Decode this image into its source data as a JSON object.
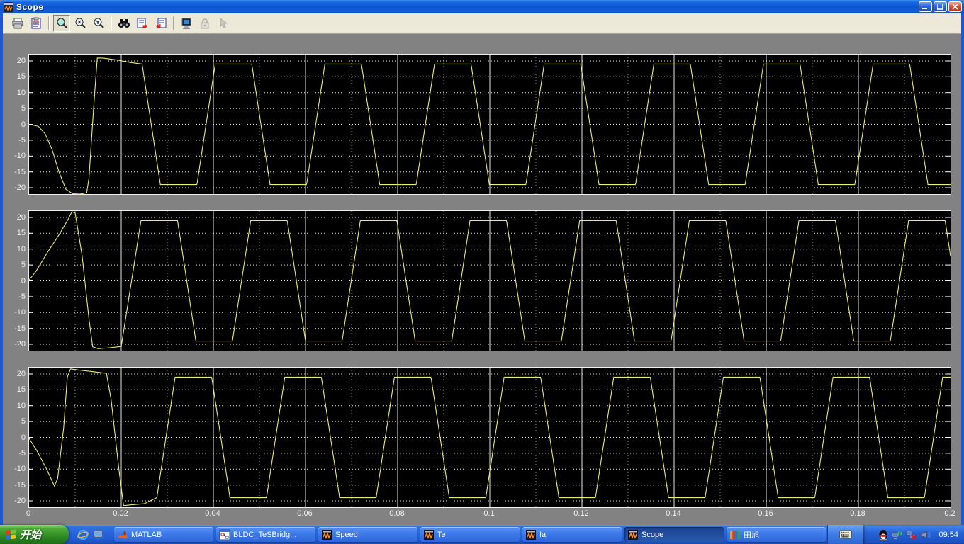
{
  "window": {
    "title": "Scope"
  },
  "toolbar": {
    "buttons": [
      {
        "name": "print-button"
      },
      {
        "name": "parameters-button"
      },
      {
        "name": "zoom-button",
        "pressed": true
      },
      {
        "name": "zoom-x-button"
      },
      {
        "name": "zoom-y-button"
      },
      {
        "name": "autoscale-button"
      },
      {
        "name": "save-axes-settings-button"
      },
      {
        "name": "restore-axes-settings-button"
      },
      {
        "name": "floating-scope-button"
      },
      {
        "name": "lock-axes-button",
        "disabled": true
      },
      {
        "name": "signal-selection-button",
        "disabled": true
      }
    ]
  },
  "chart_data": {
    "type": "line",
    "title": "",
    "xlabel": "",
    "ylabel": "",
    "xlim": [
      0,
      0.2
    ],
    "ylim": [
      -22,
      22
    ],
    "xticks": [
      0,
      0.02,
      0.04,
      0.06,
      0.08,
      0.1,
      0.12,
      0.14,
      0.16,
      0.18,
      0.2
    ],
    "xtick_labels": [
      "0",
      "0.02",
      "0.04",
      "0.06",
      "0.08",
      "0.1",
      "0.12",
      "0.14",
      "0.16",
      "0.18",
      "0.2"
    ],
    "yticks": [
      20,
      15,
      10,
      5,
      0,
      -5,
      -10,
      -15,
      -20
    ],
    "grid": "dotted-white-on-black",
    "line_color": "#ecec72",
    "plots": [
      {
        "name": "phase-current-a",
        "transient": [
          [
            0,
            0
          ],
          [
            0.002,
            -0.6
          ],
          [
            0.0035,
            -3
          ],
          [
            0.005,
            -8
          ],
          [
            0.0065,
            -15
          ],
          [
            0.008,
            -20.5
          ],
          [
            0.0095,
            -21.9
          ],
          [
            0.011,
            -22
          ],
          [
            0.0125,
            -21.6
          ],
          [
            0.013,
            -17
          ],
          [
            0.014,
            5
          ],
          [
            0.0148,
            20.9
          ],
          [
            0.016,
            20.9
          ],
          [
            0.019,
            20.3
          ],
          [
            0.022,
            19.5
          ],
          [
            0.0245,
            19
          ]
        ],
        "steady": {
          "period": 0.0238,
          "amplitude": 19,
          "top_start": 0.0166,
          "handoff": 0.0245,
          "flat_fraction": 0.3333,
          "ramp_fraction": 0.1667
        }
      },
      {
        "name": "phase-current-b",
        "transient": [
          [
            0,
            0.3
          ],
          [
            0.0015,
            3
          ],
          [
            0.004,
            9
          ],
          [
            0.0065,
            14.5
          ],
          [
            0.0085,
            19.5
          ],
          [
            0.0093,
            21.8
          ],
          [
            0.01,
            21.4
          ],
          [
            0.0115,
            8
          ],
          [
            0.013,
            -12
          ],
          [
            0.0138,
            -20.8
          ],
          [
            0.015,
            -21.4
          ],
          [
            0.0175,
            -21.1
          ],
          [
            0.02,
            -20.7
          ],
          [
            0.0243,
            19
          ]
        ],
        "steady": {
          "period": 0.0238,
          "amplitude": 19,
          "top_start": 0.0243,
          "handoff": 0.0243,
          "flat_fraction": 0.3333,
          "ramp_fraction": 0.1667
        }
      },
      {
        "name": "phase-current-c",
        "transient": [
          [
            0,
            -0.3
          ],
          [
            0.0018,
            -4.5
          ],
          [
            0.0038,
            -10
          ],
          [
            0.0055,
            -15.3
          ],
          [
            0.0062,
            -13
          ],
          [
            0.0075,
            3
          ],
          [
            0.0083,
            19
          ],
          [
            0.009,
            21.6
          ],
          [
            0.011,
            21.2
          ],
          [
            0.014,
            20.7
          ],
          [
            0.0168,
            20.2
          ],
          [
            0.0178,
            12
          ],
          [
            0.0195,
            -10
          ],
          [
            0.0205,
            -21.5
          ],
          [
            0.0225,
            -21.2
          ],
          [
            0.025,
            -20.9
          ],
          [
            0.0277,
            -19
          ]
        ],
        "steady": {
          "period": 0.0238,
          "amplitude": 19,
          "top_start": 0.0317,
          "handoff": 0.0277,
          "flat_fraction": 0.3333,
          "ramp_fraction": 0.1667
        }
      }
    ]
  },
  "taskbar": {
    "start_label": "开始",
    "quick_launch": [
      "internet-explorer-icon",
      "show-desktop-icon"
    ],
    "tasks": [
      {
        "label": "MATLAB",
        "icon": "matlab-icon",
        "active": false
      },
      {
        "label": "BLDC_TeSBridg...",
        "icon": "simulink-model-icon",
        "active": false
      },
      {
        "label": "Speed",
        "icon": "scope-icon",
        "active": false
      },
      {
        "label": "Te",
        "icon": "scope-icon",
        "active": false
      },
      {
        "label": "Ia",
        "icon": "scope-icon",
        "active": false
      },
      {
        "label": "Scope",
        "icon": "scope-icon",
        "active": true
      },
      {
        "label": "田旭",
        "icon": "folder-icon",
        "active": false
      }
    ],
    "language_indicator": "keyboard-icon",
    "tray": {
      "icons": [
        "qq-icon",
        "network-activity-icon",
        "network-error-icon",
        "volume-icon"
      ],
      "clock": "09:54"
    }
  }
}
